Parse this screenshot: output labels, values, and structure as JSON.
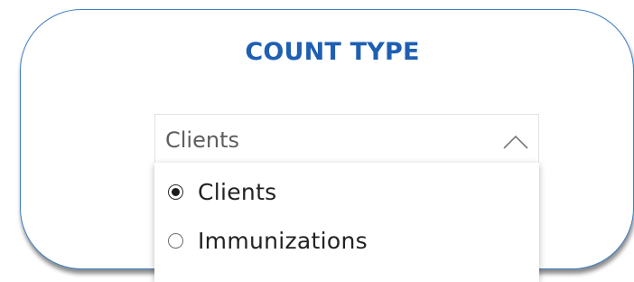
{
  "slicer": {
    "title": "COUNT TYPE",
    "selected_value": "Clients",
    "expanded": true,
    "options": [
      {
        "label": "Clients",
        "selected": true
      },
      {
        "label": "Immunizations",
        "selected": false
      }
    ]
  },
  "icons": {
    "toggle": "chevron-up-icon",
    "option_selected": "radio-checked-icon",
    "option_unselected": "radio-unchecked-icon"
  },
  "colors": {
    "title": "#1f5fb3",
    "card_border": "#3f7fc4",
    "header_text": "#5e5e5e",
    "option_text": "#222222"
  }
}
